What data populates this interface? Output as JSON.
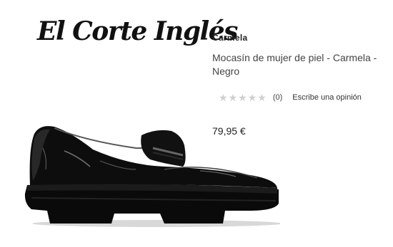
{
  "logo": {
    "text": "El Corte Inglés",
    "icon": "el-corte-ingles-logo"
  },
  "product": {
    "brand": "Carmela",
    "title": "Mocasín de mujer de piel - Carmela - Negro",
    "price": "79,95 €",
    "image": {
      "icon": "black-patent-loafer",
      "color": "#0d0d0d"
    }
  },
  "rating": {
    "stars_filled": 0,
    "stars_total": 5,
    "count_text": "(0)",
    "review_link": "Escribe una opinión",
    "star_color": "#cfcfcf"
  }
}
